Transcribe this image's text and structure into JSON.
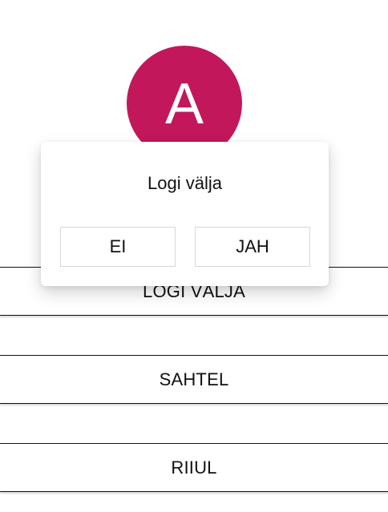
{
  "profile": {
    "avatar_letter": "A",
    "avatar_color": "#c2185b"
  },
  "menu": {
    "logout_label": "LOGI VÄLJA",
    "drawer_label": "SAHTEL",
    "shelf_label": "RIIUL"
  },
  "dialog": {
    "title": "Logi välja",
    "no_label": "EI",
    "yes_label": "JAH"
  }
}
